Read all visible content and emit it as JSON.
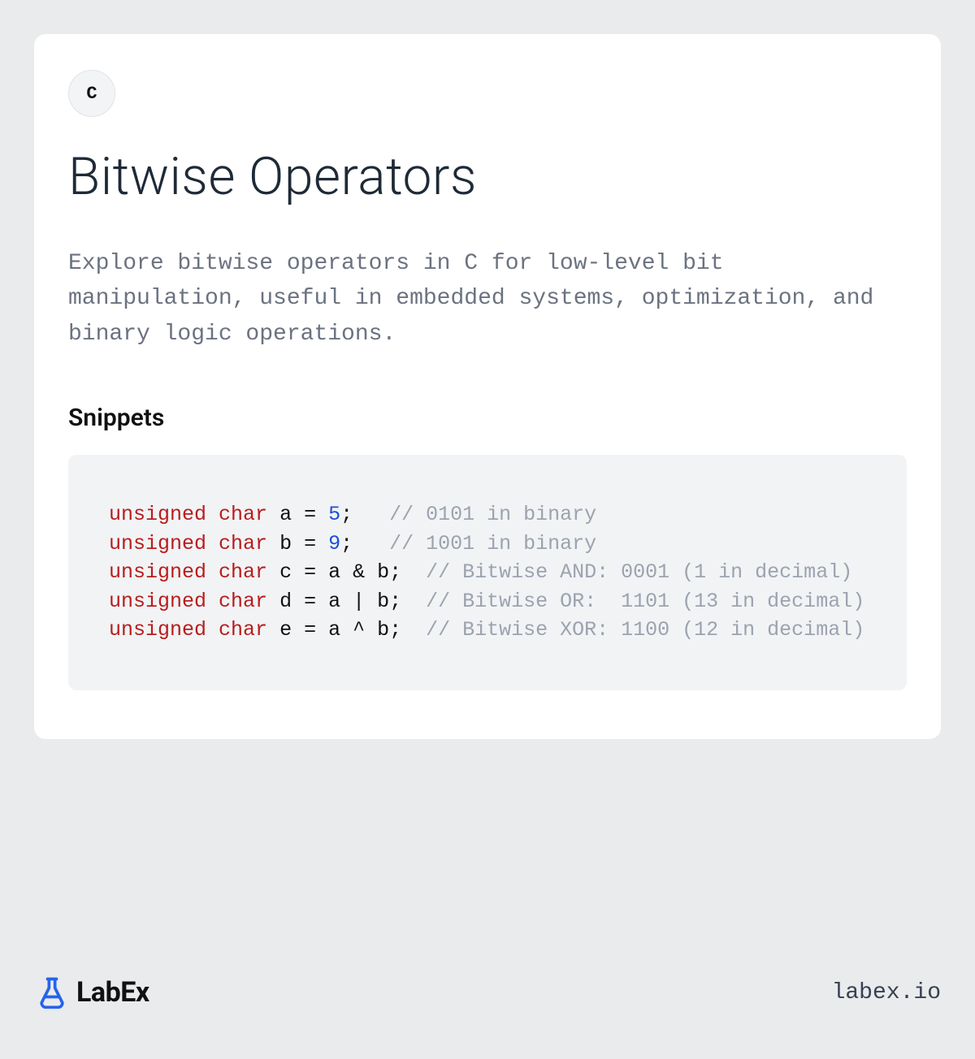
{
  "badge": "C",
  "title": "Bitwise Operators",
  "description": "Explore bitwise operators in C for low-level bit manipulation, useful in embedded systems, optimization, and binary logic operations.",
  "snippets_heading": "Snippets",
  "code": {
    "lines": [
      {
        "tokens": [
          {
            "t": "unsigned",
            "c": "keyword"
          },
          {
            "t": " ",
            "c": ""
          },
          {
            "t": "char",
            "c": "keyword"
          },
          {
            "t": " a = ",
            "c": ""
          },
          {
            "t": "5",
            "c": "number"
          },
          {
            "t": ";   ",
            "c": ""
          },
          {
            "t": "// 0101 in binary",
            "c": "comment"
          }
        ]
      },
      {
        "tokens": [
          {
            "t": "unsigned",
            "c": "keyword"
          },
          {
            "t": " ",
            "c": ""
          },
          {
            "t": "char",
            "c": "keyword"
          },
          {
            "t": " b = ",
            "c": ""
          },
          {
            "t": "9",
            "c": "number"
          },
          {
            "t": ";   ",
            "c": ""
          },
          {
            "t": "// 1001 in binary",
            "c": "comment"
          }
        ]
      },
      {
        "tokens": [
          {
            "t": "unsigned",
            "c": "keyword"
          },
          {
            "t": " ",
            "c": ""
          },
          {
            "t": "char",
            "c": "keyword"
          },
          {
            "t": " c = a & b;  ",
            "c": ""
          },
          {
            "t": "// Bitwise AND: 0001 (1 in decimal)",
            "c": "comment"
          }
        ]
      },
      {
        "tokens": [
          {
            "t": "unsigned",
            "c": "keyword"
          },
          {
            "t": " ",
            "c": ""
          },
          {
            "t": "char",
            "c": "keyword"
          },
          {
            "t": " d = a | b;  ",
            "c": ""
          },
          {
            "t": "// Bitwise OR:  1101 (13 in decimal)",
            "c": "comment"
          }
        ]
      },
      {
        "tokens": [
          {
            "t": "unsigned",
            "c": "keyword"
          },
          {
            "t": " ",
            "c": ""
          },
          {
            "t": "char",
            "c": "keyword"
          },
          {
            "t": " e = a ^ b;  ",
            "c": ""
          },
          {
            "t": "// Bitwise XOR: 1100 (12 in decimal)",
            "c": "comment"
          }
        ]
      }
    ]
  },
  "footer": {
    "brand": "LabEx",
    "site": "labex.io"
  }
}
